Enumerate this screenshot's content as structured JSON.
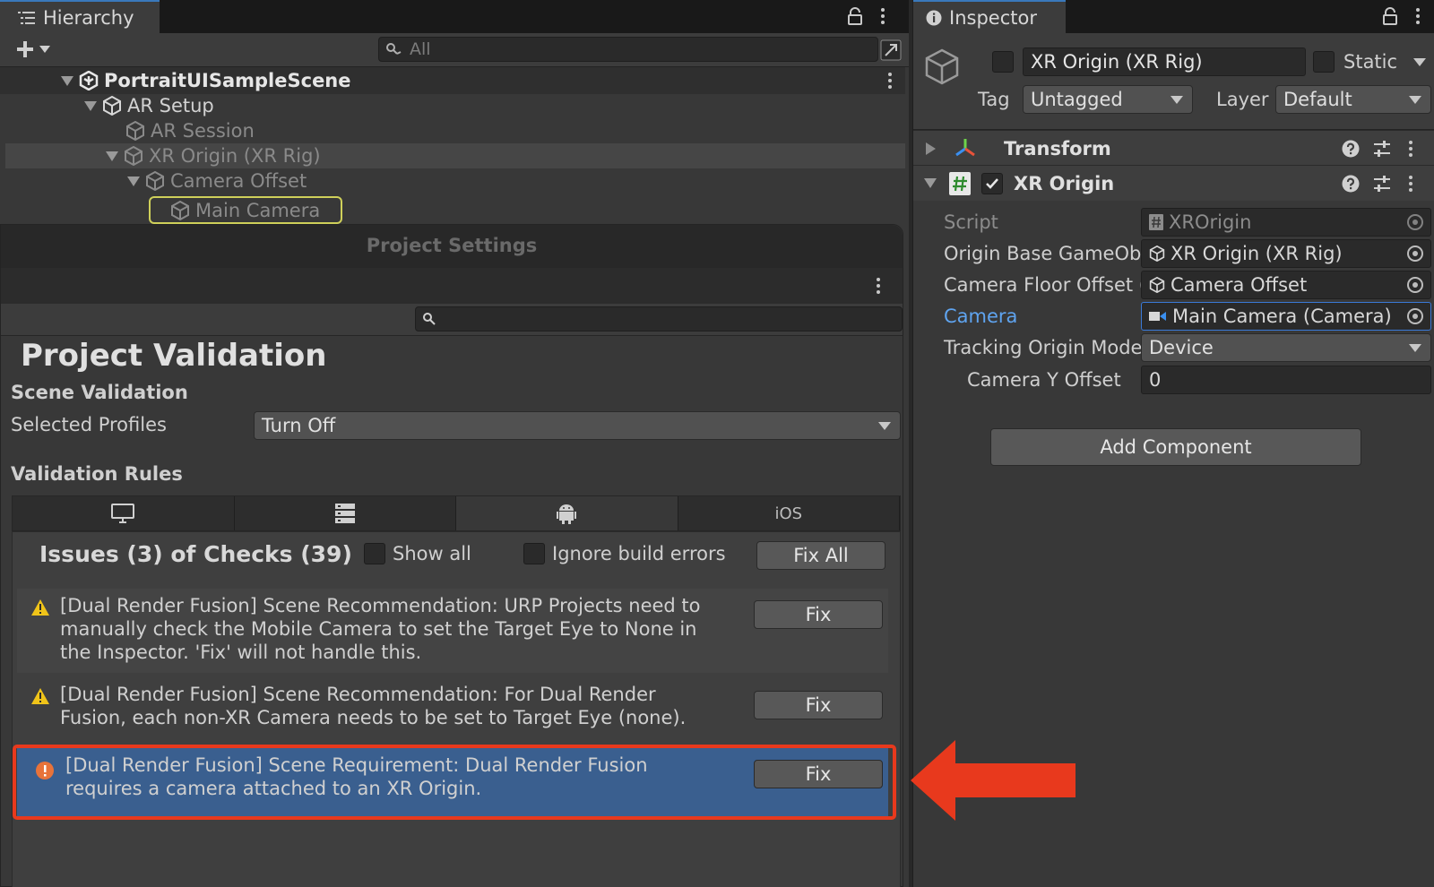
{
  "hierarchy": {
    "tab_label": "Hierarchy",
    "search_placeholder": "All",
    "scene_name": "PortraitUISampleScene",
    "items": [
      {
        "label": "AR Setup"
      },
      {
        "label": "AR Session"
      },
      {
        "label": "XR Origin (XR Rig)"
      },
      {
        "label": "Camera Offset"
      },
      {
        "label": "Main Camera"
      }
    ]
  },
  "project_settings": {
    "window_title": "Project Settings",
    "page_title": "Project Validation",
    "scene_validation_label": "Scene Validation",
    "selected_profiles_label": "Selected Profiles",
    "selected_profiles_value": "Turn Off",
    "validation_rules_label": "Validation Rules",
    "platform_tabs": [
      {
        "name": "standalone",
        "icon": "monitor-icon",
        "label": ""
      },
      {
        "name": "server",
        "icon": "server-icon",
        "label": ""
      },
      {
        "name": "android",
        "icon": "android-icon",
        "label": ""
      },
      {
        "name": "ios",
        "icon": "",
        "label": "iOS"
      }
    ],
    "active_tab": "android",
    "issues_summary": "Issues (3) of Checks (39)",
    "show_all_label": "Show all",
    "ignore_build_errors_label": "Ignore build errors",
    "fix_all_label": "Fix All",
    "issues": [
      {
        "severity": "warning",
        "text": "[Dual Render Fusion] Scene Recommendation: URP Projects need to manually check the Mobile Camera to set the Target Eye to None in the Inspector. 'Fix' will not handle this.",
        "fix_label": "Fix"
      },
      {
        "severity": "warning",
        "text": "[Dual Render Fusion] Scene Recommendation: For Dual Render Fusion, each non-XR Camera needs to be set to Target Eye (none).",
        "fix_label": "Fix"
      },
      {
        "severity": "error",
        "text": "[Dual Render Fusion] Scene Requirement: Dual Render Fusion requires a camera attached to an XR Origin.",
        "fix_label": "Fix"
      }
    ]
  },
  "inspector": {
    "tab_label": "Inspector",
    "object_name": "XR Origin (XR Rig)",
    "static_label": "Static",
    "tag_label": "Tag",
    "tag_value": "Untagged",
    "layer_label": "Layer",
    "layer_value": "Default",
    "transform_label": "Transform",
    "component_label": "XR Origin",
    "fields": {
      "script": {
        "label": "Script",
        "value": "XROrigin"
      },
      "origin_base": {
        "label": "Origin Base GameObj",
        "value": "XR Origin (XR Rig)"
      },
      "camera_floor_offset": {
        "label": "Camera Floor Offset (",
        "value": "Camera Offset"
      },
      "camera": {
        "label": "Camera",
        "value": "Main Camera (Camera)"
      },
      "tracking_origin_mode": {
        "label": "Tracking Origin Mode",
        "value": "Device"
      },
      "camera_y_offset": {
        "label": "Camera Y Offset",
        "value": "0"
      }
    },
    "add_component_label": "Add Component"
  },
  "colors": {
    "highlight_border": "#e8391d",
    "selected_issue_bg": "#3a5f8f",
    "warning": "#f0c419",
    "error": "#e8733a",
    "camera_label": "#5fa4f0"
  }
}
